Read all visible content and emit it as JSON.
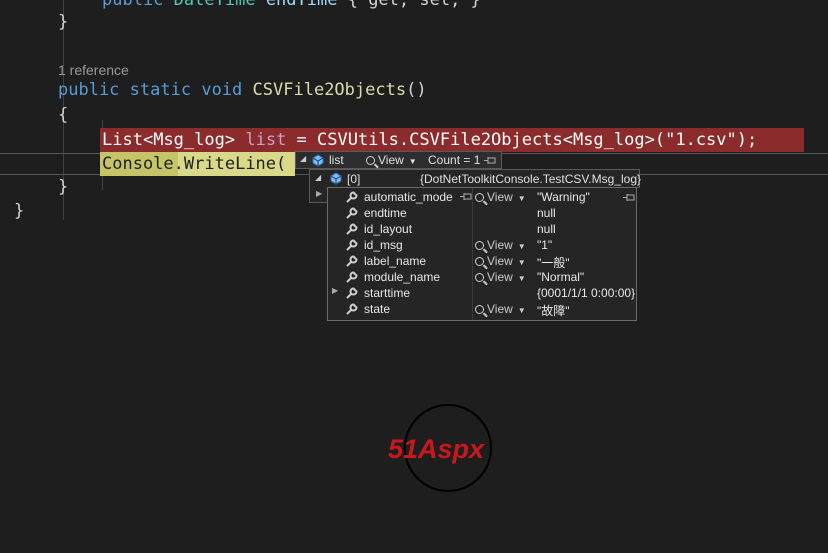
{
  "code": {
    "line_top": {
      "kw1": "public",
      "type": "DateTime",
      "name": "endTime",
      "body": "{ get; set; }"
    },
    "brace_close_prop": "}",
    "codelens": "1 reference",
    "method_kw1": "public",
    "method_kw2": "static",
    "method_kw3": "void",
    "method_name": "CSVFile2Objects",
    "method_parens": "()",
    "brace_open": "{",
    "stmt1": {
      "type_list": "List",
      "lt": "<",
      "type_msg": "Msg_log",
      "gt": ">",
      "var": "list",
      "eq": " = ",
      "cls": "CSVUtils",
      "dot": ".",
      "fn": "CSVFile2Objects",
      "lt2": "<",
      "type_msg2": "Msg_log",
      "gt2": ">",
      "paren_open": "(",
      "str": "\"1.csv\"",
      "tail": ");"
    },
    "stmt2": {
      "cls": "Console",
      "dot": ".",
      "fn": "WriteLine",
      "paren": "("
    },
    "brace_close_method": "}",
    "brace_close_class": "}"
  },
  "datatip": {
    "header": {
      "name": "list",
      "view_label": "View",
      "count_text": "Count = 1"
    },
    "item0": {
      "name": "[0]",
      "value": "{DotNetToolkitConsole.TestCSV.Msg_log}"
    },
    "rows": [
      {
        "name": "automatic_mode",
        "has_view": true,
        "view_label": "View",
        "value": "\"Warning\""
      },
      {
        "name": "endtime",
        "has_view": false,
        "view_label": "",
        "value": "null"
      },
      {
        "name": "id_layout",
        "has_view": false,
        "view_label": "",
        "value": "null"
      },
      {
        "name": "id_msg",
        "has_view": true,
        "view_label": "View",
        "value": "\"1\""
      },
      {
        "name": "label_name",
        "has_view": true,
        "view_label": "View",
        "value": "\"一般\""
      },
      {
        "name": "module_name",
        "has_view": true,
        "view_label": "View",
        "value": "\"Normal\""
      },
      {
        "name": "starttime",
        "has_view": false,
        "view_label": "",
        "value": "{0001/1/1 0:00:00}"
      },
      {
        "name": "state",
        "has_view": true,
        "view_label": "View",
        "value": "\"故障\""
      }
    ]
  },
  "watermark": {
    "text": "51Aspx"
  },
  "colors": {
    "breakpoint": "#8b2b2b",
    "current_line": "#c5c567",
    "keyword": "#569cd6",
    "type": "#4ec9b0",
    "method": "#dcdcaa",
    "string": "#ce9178"
  }
}
